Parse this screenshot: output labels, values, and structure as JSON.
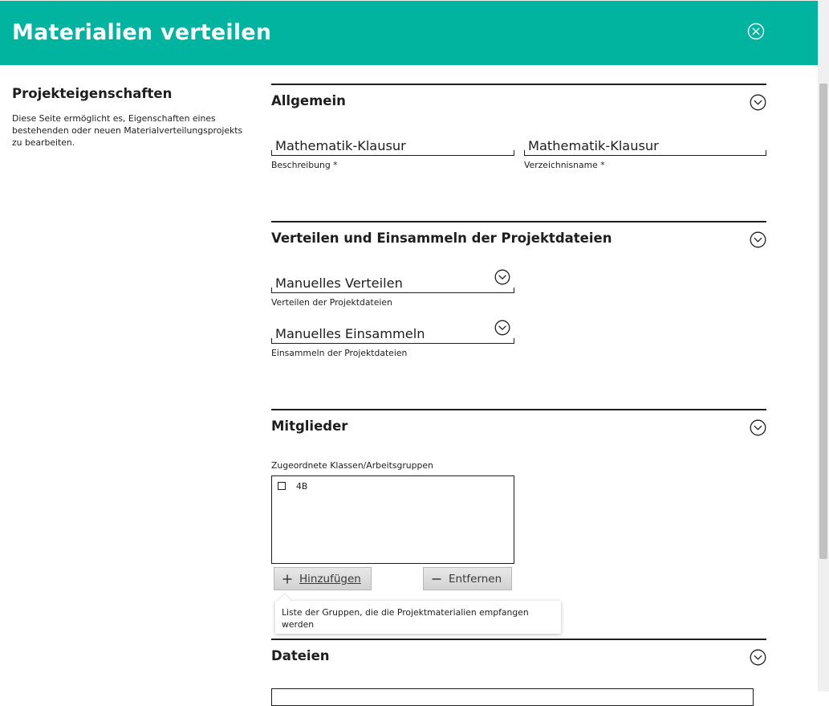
{
  "header": {
    "title": "Materialien verteilen"
  },
  "sidebar": {
    "title": "Projekteigenschaften",
    "description": "Diese Seite ermöglicht es, Eigenschaften eines bestehenden oder neuen Materialverteilungsprojekts zu bearbeiten."
  },
  "sections": {
    "general": {
      "title": "Allgemein",
      "description": {
        "value": "Mathematik-Klausur",
        "label": "Beschreibung *"
      },
      "directory": {
        "value": "Mathematik-Klausur",
        "label": "Verzeichnisname *"
      }
    },
    "distribution": {
      "title": "Verteilen und Einsammeln der Projektdateien",
      "distribute": {
        "value": "Manuelles Verteilen",
        "label": "Verteilen der Projektdateien"
      },
      "collect": {
        "value": "Manuelles Einsammeln",
        "label": "Einsammeln der Projektdateien"
      }
    },
    "members": {
      "title": "Mitglieder",
      "list_label": "Zugeordnete Klassen/Arbeitsgruppen",
      "items": [
        {
          "label": "4B",
          "checked": false
        }
      ],
      "add_label": "Hinzufügen",
      "remove_label": "Entfernen",
      "tooltip": "Liste der Gruppen, die die Projektmaterialien empfangen werden"
    },
    "files": {
      "title": "Dateien"
    }
  },
  "colors": {
    "header_bg": "#00b4a0",
    "header_text": "#ffffff",
    "text": "#1e1e1e"
  },
  "icons": {
    "close": "close-circle-icon",
    "toggle": "chevron-down-circle-icon",
    "add": "plus-icon",
    "remove": "minus-icon"
  }
}
